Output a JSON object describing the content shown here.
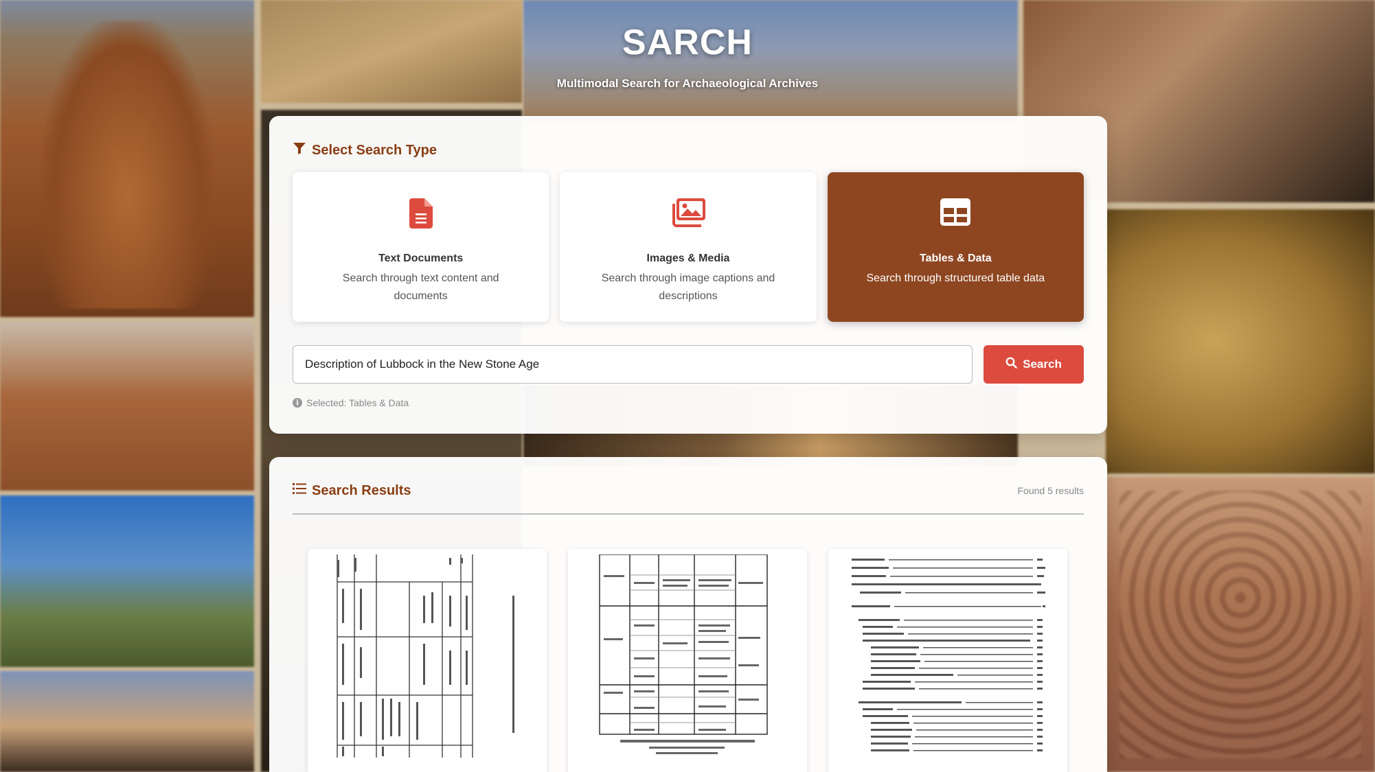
{
  "app": {
    "title": "SARCH",
    "subtitle": "Multimodal Search for Archaeological Archives"
  },
  "search_panel": {
    "heading": "Select Search Type",
    "types": [
      {
        "title": "Text Documents",
        "description": "Search through text content and documents",
        "icon": "file-text-icon",
        "selected": false
      },
      {
        "title": "Images & Media",
        "description": "Search through image captions and descriptions",
        "icon": "images-icon",
        "selected": false
      },
      {
        "title": "Tables & Data",
        "description": "Search through structured table data",
        "icon": "table-icon",
        "selected": true
      }
    ],
    "query_value": "Description of Lubbock in the New Stone Age",
    "search_button_label": "Search",
    "selected_note": "Selected: Tables & Data"
  },
  "results_panel": {
    "heading": "Search Results",
    "count_text": "Found 5 results",
    "thumbnails": [
      {
        "kind": "rotated-classification-table"
      },
      {
        "kind": "stone-age-history-table"
      },
      {
        "kind": "table-of-contents"
      }
    ]
  },
  "colors": {
    "accent": "#8e4621",
    "heading": "#8a3d12",
    "search_button": "#dc4b3e",
    "icon_red": "#dc4b3e"
  }
}
